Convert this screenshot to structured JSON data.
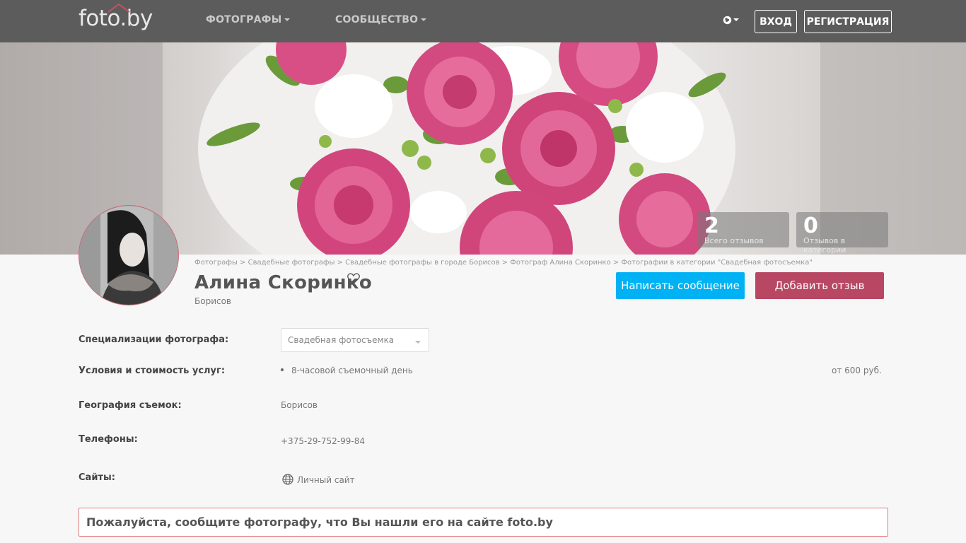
{
  "header": {
    "logo": "foto.by",
    "nav": [
      {
        "label": "ФОТОГРАФЫ"
      },
      {
        "label": "СООБЩЕСТВО"
      }
    ],
    "login_label": "ВХОД",
    "register_label": "РЕГИСТРАЦИЯ"
  },
  "stats": [
    {
      "value": "2",
      "label": "Всего отзывов"
    },
    {
      "value": "0",
      "label": "Отзывов в категории"
    }
  ],
  "breadcrumb": "Фотографы > Свадебные фотографы > Свадебные фотографы в городе Борисов > Фотограф Алина Скоринко > Фотографии в категории \"Свадебная фотосъемка\"",
  "profile": {
    "name": "Алина Скоринко",
    "city": "Борисов"
  },
  "actions": {
    "message_label": "Написать сообщение",
    "review_label": "Добавить отзыв"
  },
  "details": {
    "specializations_label": "Специализации фотографа:",
    "specialization_value": "Свадебная фотосъемка",
    "services_label": "Условия и стоимость услуг:",
    "service_name": "8-часовой съемочный день",
    "service_price": "от 600 руб.",
    "geography_label": "География съемок:",
    "geography_value": "Борисов",
    "phones_label": "Телефоны:",
    "phone_value": "+375-29-752-99-84",
    "sites_label": "Сайты:",
    "site_value": "Личный сайт"
  },
  "notice": "Пожалуйста, сообщите фотографу, что Вы нашли его на сайте foto.by",
  "colors": {
    "topbar": "#5c5c5c",
    "message_button": "#00b2f4",
    "review_button": "#b74763",
    "notice_border": "#e07b7f"
  }
}
